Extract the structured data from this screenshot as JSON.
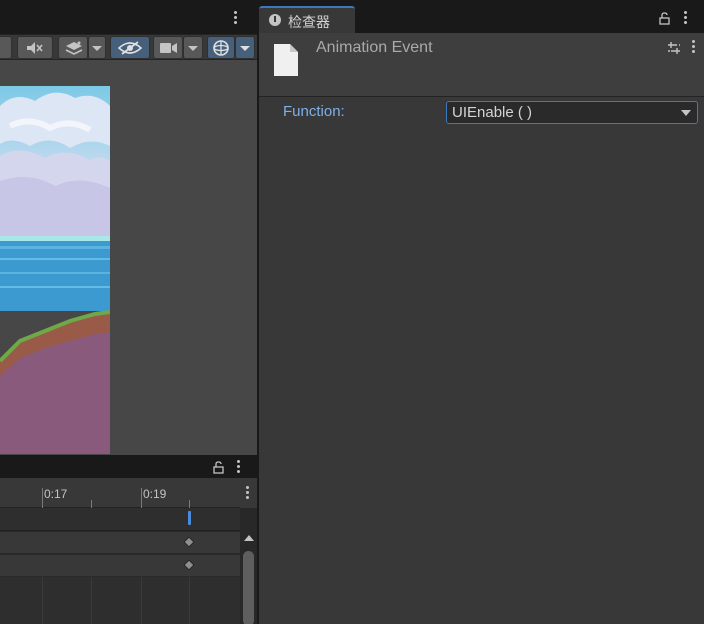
{
  "inspector": {
    "tab_label": "检查器",
    "title": "Animation Event",
    "function_label": "Function:",
    "function_value": "UIEnable ( )"
  },
  "animation": {
    "ruler_labels": [
      "0:17",
      "0:19"
    ]
  },
  "icons": {
    "scene_toolbar": [
      "audio-mute-icon",
      "effects-layers-icon",
      "dropdown-arrow-icon",
      "scene-visibility-icon",
      "camera-icon",
      "dropdown-arrow-icon",
      "gizmos-icon",
      "dropdown-arrow-icon"
    ],
    "inspector": [
      "info-icon",
      "lock-icon",
      "kebab-menu-icon",
      "document-icon",
      "presets-icon"
    ]
  },
  "colors": {
    "accent": "#3a79bb",
    "label_blue": "#7cb1ea",
    "event_marker": "#4a8be0",
    "toolbar_active": "#46607c"
  }
}
